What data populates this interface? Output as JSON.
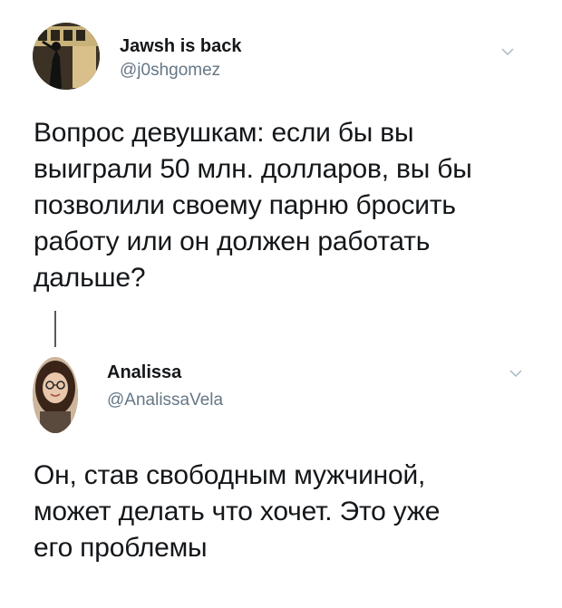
{
  "tweets": [
    {
      "display_name": "Jawsh is back",
      "handle": "@j0shgomez",
      "text_lines": [
        "Вопрос девушкам: если бы вы",
        "выиграли 50 млн. долларов, вы бы",
        "позволили своему парню бросить",
        "работу или он должен работать",
        "дальше?"
      ],
      "avatar_icon": "user-avatar-photo-icon",
      "menu_icon": "chevron-down-icon"
    },
    {
      "display_name": "Analissa",
      "handle": "@AnalissaVela",
      "text_lines": [
        "Он, став свободным мужчиной,",
        "может делать что хочет. Это уже",
        "его проблемы"
      ],
      "avatar_icon": "user-avatar-photo-icon",
      "menu_icon": "chevron-down-icon"
    }
  ],
  "colors": {
    "text": "#14171a",
    "secondary_text": "#657786",
    "thread_line": "#5a5a5a",
    "chevron": "#aab8c2"
  }
}
